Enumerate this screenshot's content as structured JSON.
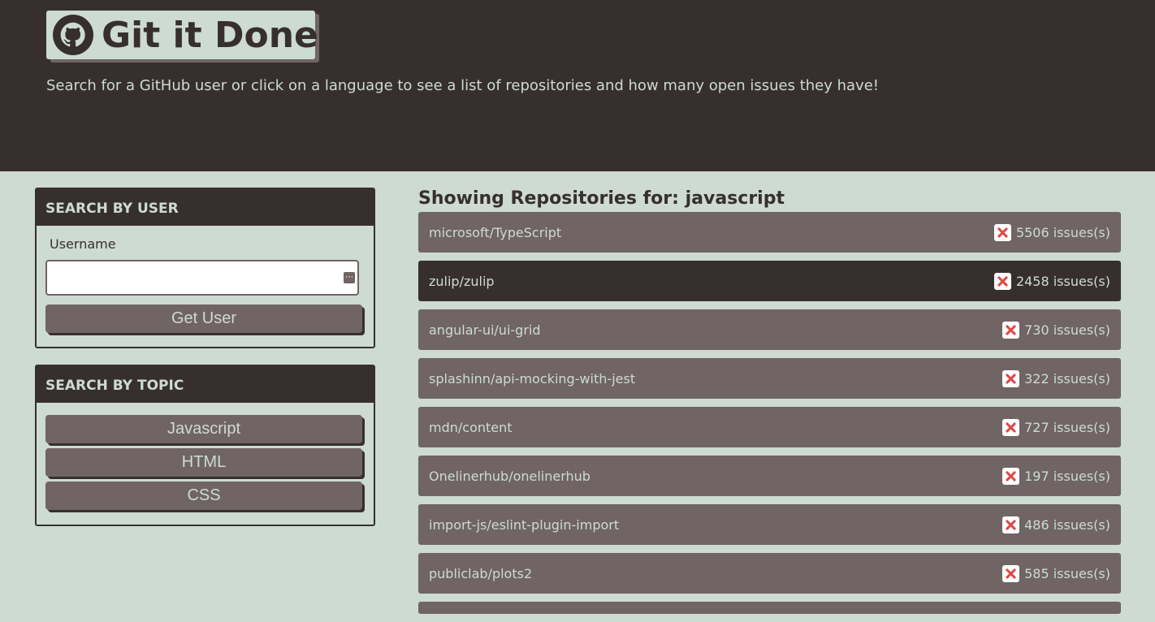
{
  "header": {
    "title": "Git it Done!",
    "subtitle": "Search for a GitHub user or click on a language to see a list of repositories and how many open issues they have!",
    "logo_icon": "github-icon"
  },
  "search_user": {
    "heading": "SEARCH BY USER",
    "label": "Username",
    "value": "",
    "button_label": "Get User"
  },
  "search_topic": {
    "heading": "SEARCH BY TOPIC",
    "buttons": [
      "Javascript",
      "HTML",
      "CSS"
    ]
  },
  "results": {
    "title": "Showing Repositories for: javascript",
    "status_icon": "x-icon",
    "repos": [
      {
        "name": "microsoft/TypeScript",
        "issues": "5506 issues(s)"
      },
      {
        "name": "zulip/zulip",
        "issues": "2458 issues(s)"
      },
      {
        "name": "angular-ui/ui-grid",
        "issues": "730 issues(s)"
      },
      {
        "name": "splashinn/api-mocking-with-jest",
        "issues": "322 issues(s)"
      },
      {
        "name": "mdn/content",
        "issues": "727 issues(s)"
      },
      {
        "name": "Onelinerhub/onelinerhub",
        "issues": "197 issues(s)"
      },
      {
        "name": "import-js/eslint-plugin-import",
        "issues": "486 issues(s)"
      },
      {
        "name": "publiclab/plots2",
        "issues": "585 issues(s)"
      }
    ]
  },
  "colors": {
    "dark": "#372f2f",
    "mid": "#706464",
    "light": "#cddbd2",
    "error": "#e04848"
  }
}
